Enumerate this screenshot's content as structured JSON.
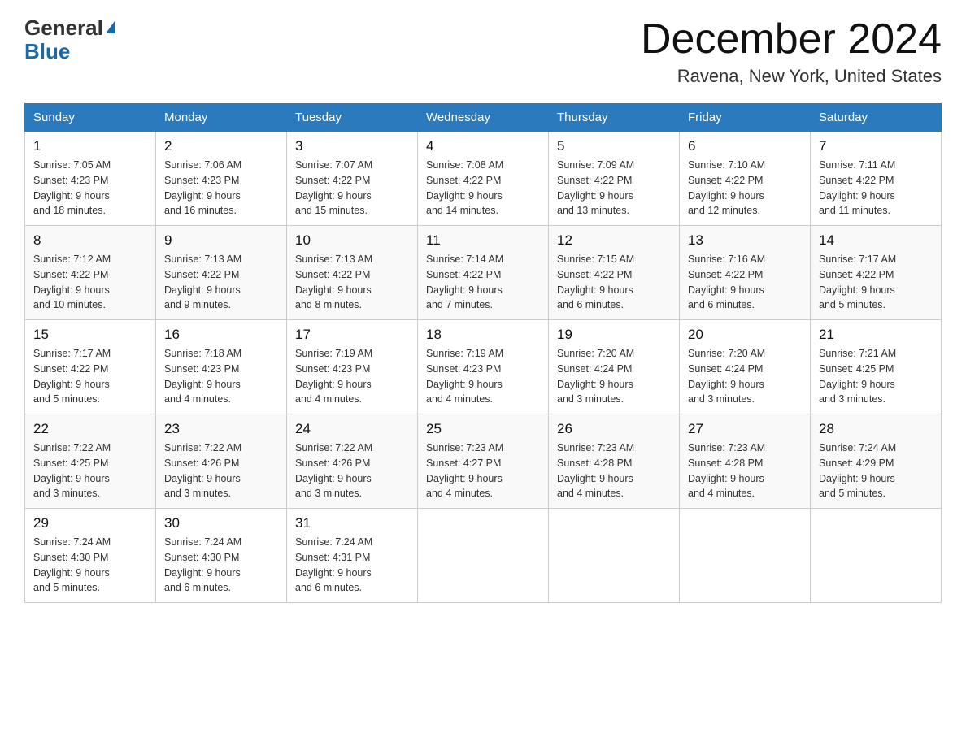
{
  "header": {
    "logo_general": "General",
    "logo_blue": "Blue",
    "month_title": "December 2024",
    "location": "Ravena, New York, United States"
  },
  "days_of_week": [
    "Sunday",
    "Monday",
    "Tuesday",
    "Wednesday",
    "Thursday",
    "Friday",
    "Saturday"
  ],
  "weeks": [
    [
      {
        "num": "1",
        "sunrise": "7:05 AM",
        "sunset": "4:23 PM",
        "daylight": "9 hours and 18 minutes."
      },
      {
        "num": "2",
        "sunrise": "7:06 AM",
        "sunset": "4:23 PM",
        "daylight": "9 hours and 16 minutes."
      },
      {
        "num": "3",
        "sunrise": "7:07 AM",
        "sunset": "4:22 PM",
        "daylight": "9 hours and 15 minutes."
      },
      {
        "num": "4",
        "sunrise": "7:08 AM",
        "sunset": "4:22 PM",
        "daylight": "9 hours and 14 minutes."
      },
      {
        "num": "5",
        "sunrise": "7:09 AM",
        "sunset": "4:22 PM",
        "daylight": "9 hours and 13 minutes."
      },
      {
        "num": "6",
        "sunrise": "7:10 AM",
        "sunset": "4:22 PM",
        "daylight": "9 hours and 12 minutes."
      },
      {
        "num": "7",
        "sunrise": "7:11 AM",
        "sunset": "4:22 PM",
        "daylight": "9 hours and 11 minutes."
      }
    ],
    [
      {
        "num": "8",
        "sunrise": "7:12 AM",
        "sunset": "4:22 PM",
        "daylight": "9 hours and 10 minutes."
      },
      {
        "num": "9",
        "sunrise": "7:13 AM",
        "sunset": "4:22 PM",
        "daylight": "9 hours and 9 minutes."
      },
      {
        "num": "10",
        "sunrise": "7:13 AM",
        "sunset": "4:22 PM",
        "daylight": "9 hours and 8 minutes."
      },
      {
        "num": "11",
        "sunrise": "7:14 AM",
        "sunset": "4:22 PM",
        "daylight": "9 hours and 7 minutes."
      },
      {
        "num": "12",
        "sunrise": "7:15 AM",
        "sunset": "4:22 PM",
        "daylight": "9 hours and 6 minutes."
      },
      {
        "num": "13",
        "sunrise": "7:16 AM",
        "sunset": "4:22 PM",
        "daylight": "9 hours and 6 minutes."
      },
      {
        "num": "14",
        "sunrise": "7:17 AM",
        "sunset": "4:22 PM",
        "daylight": "9 hours and 5 minutes."
      }
    ],
    [
      {
        "num": "15",
        "sunrise": "7:17 AM",
        "sunset": "4:22 PM",
        "daylight": "9 hours and 5 minutes."
      },
      {
        "num": "16",
        "sunrise": "7:18 AM",
        "sunset": "4:23 PM",
        "daylight": "9 hours and 4 minutes."
      },
      {
        "num": "17",
        "sunrise": "7:19 AM",
        "sunset": "4:23 PM",
        "daylight": "9 hours and 4 minutes."
      },
      {
        "num": "18",
        "sunrise": "7:19 AM",
        "sunset": "4:23 PM",
        "daylight": "9 hours and 4 minutes."
      },
      {
        "num": "19",
        "sunrise": "7:20 AM",
        "sunset": "4:24 PM",
        "daylight": "9 hours and 3 minutes."
      },
      {
        "num": "20",
        "sunrise": "7:20 AM",
        "sunset": "4:24 PM",
        "daylight": "9 hours and 3 minutes."
      },
      {
        "num": "21",
        "sunrise": "7:21 AM",
        "sunset": "4:25 PM",
        "daylight": "9 hours and 3 minutes."
      }
    ],
    [
      {
        "num": "22",
        "sunrise": "7:22 AM",
        "sunset": "4:25 PM",
        "daylight": "9 hours and 3 minutes."
      },
      {
        "num": "23",
        "sunrise": "7:22 AM",
        "sunset": "4:26 PM",
        "daylight": "9 hours and 3 minutes."
      },
      {
        "num": "24",
        "sunrise": "7:22 AM",
        "sunset": "4:26 PM",
        "daylight": "9 hours and 3 minutes."
      },
      {
        "num": "25",
        "sunrise": "7:23 AM",
        "sunset": "4:27 PM",
        "daylight": "9 hours and 4 minutes."
      },
      {
        "num": "26",
        "sunrise": "7:23 AM",
        "sunset": "4:28 PM",
        "daylight": "9 hours and 4 minutes."
      },
      {
        "num": "27",
        "sunrise": "7:23 AM",
        "sunset": "4:28 PM",
        "daylight": "9 hours and 4 minutes."
      },
      {
        "num": "28",
        "sunrise": "7:24 AM",
        "sunset": "4:29 PM",
        "daylight": "9 hours and 5 minutes."
      }
    ],
    [
      {
        "num": "29",
        "sunrise": "7:24 AM",
        "sunset": "4:30 PM",
        "daylight": "9 hours and 5 minutes."
      },
      {
        "num": "30",
        "sunrise": "7:24 AM",
        "sunset": "4:30 PM",
        "daylight": "9 hours and 6 minutes."
      },
      {
        "num": "31",
        "sunrise": "7:24 AM",
        "sunset": "4:31 PM",
        "daylight": "9 hours and 6 minutes."
      },
      null,
      null,
      null,
      null
    ]
  ],
  "labels": {
    "sunrise": "Sunrise:",
    "sunset": "Sunset:",
    "daylight": "Daylight:"
  }
}
